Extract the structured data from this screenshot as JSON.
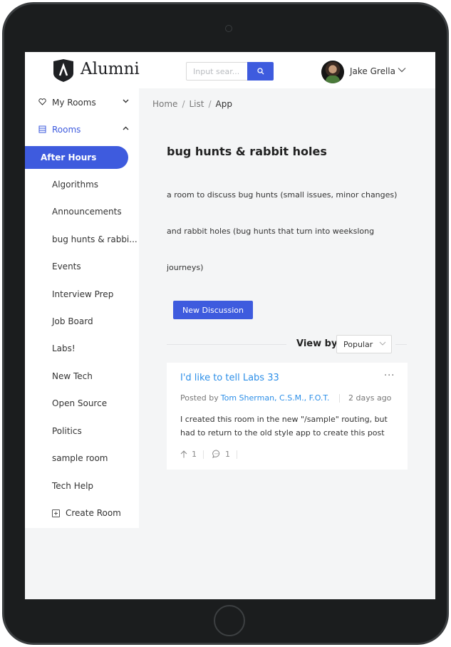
{
  "app": {
    "name": "Alumni"
  },
  "search": {
    "placeholder": "Input sear..."
  },
  "user": {
    "name": "Jake Grella"
  },
  "sidebar": {
    "my_rooms": "My Rooms",
    "rooms": "Rooms",
    "active": "After Hours",
    "items": [
      "Algorithms",
      "Announcements",
      "bug hunts & rabbi...",
      "Events",
      "Interview Prep",
      "Job Board",
      "Labs!",
      "New Tech",
      "Open Source",
      "Politics",
      "sample room",
      "Tech Help"
    ],
    "create_room": "Create Room"
  },
  "breadcrumb": [
    "Home",
    "List",
    "App"
  ],
  "room": {
    "title": "bug hunts & rabbit holes",
    "description_lines": [
      "a room to discuss bug hunts (small issues, minor changes)",
      "and rabbit holes (bug hunts that turn into weekslong",
      "journeys)"
    ]
  },
  "actions": {
    "new_discussion": "New Discussion"
  },
  "view_by": {
    "label": "View by:",
    "selected": "Popular"
  },
  "post": {
    "title": "I'd like to tell Labs 33",
    "posted_by_label": "Posted by",
    "author": "Tom Sherman, C.S.M., F.O.T.",
    "time": "2 days ago",
    "body_lines": [
      "I created this room in the new \"/sample\" routing, but",
      "had to return to the old style app to create this post"
    ],
    "upvotes": "1",
    "comments": "1"
  },
  "colors": {
    "accent": "#3e5bde",
    "link": "#2d8fe8",
    "frame": "#1b1d1e",
    "background": "#f4f5f6"
  }
}
